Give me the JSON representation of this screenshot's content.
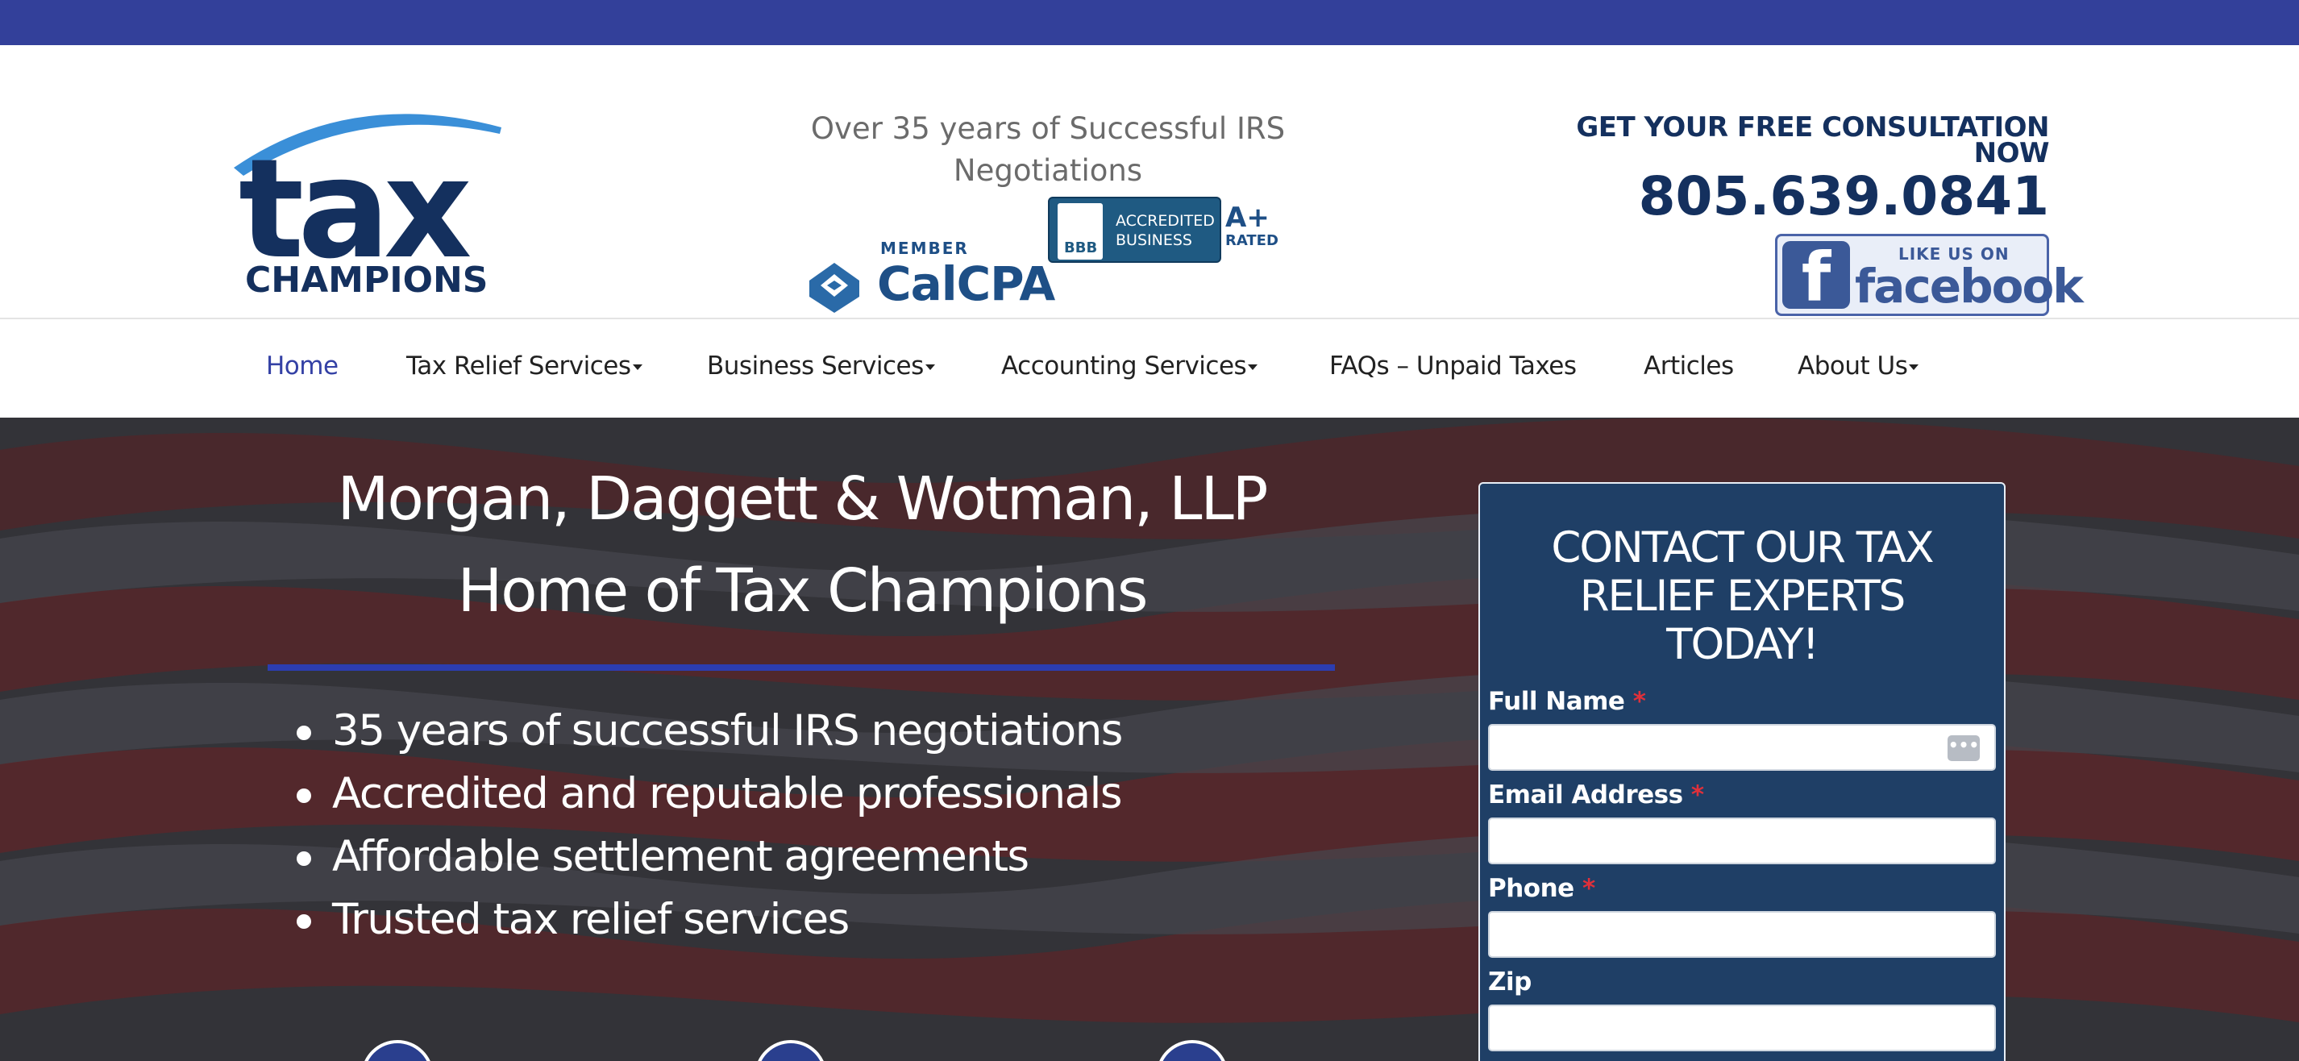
{
  "brand": {
    "logo_word": "tax",
    "logo_sub": "CHAMPIONS",
    "colors": {
      "navy": "#14305e",
      "accent_blue": "#3a8fd8",
      "topbar": "#33409a"
    }
  },
  "header": {
    "tagline": "Over 35 years of Successful IRS Negotiations",
    "calcpa_member": "MEMBER",
    "calcpa_name": "CalCPA",
    "bbb_seal": "BBB",
    "bbb_line1": "ACCREDITED",
    "bbb_line2": "BUSINESS",
    "bbb_rating": "A+",
    "bbb_rated": "RATED",
    "cta": "GET YOUR FREE CONSULTATION NOW",
    "phone": "805.639.0841",
    "fb_like": "LIKE US ON",
    "fb_word": "facebook",
    "fb_letter": "f"
  },
  "nav": {
    "items": [
      {
        "label": "Home",
        "active": true,
        "dropdown": false
      },
      {
        "label": "Tax Relief Services",
        "active": false,
        "dropdown": true
      },
      {
        "label": "Business Services",
        "active": false,
        "dropdown": true
      },
      {
        "label": "Accounting Services",
        "active": false,
        "dropdown": true
      },
      {
        "label": "FAQs – Unpaid Taxes",
        "active": false,
        "dropdown": false
      },
      {
        "label": "Articles",
        "active": false,
        "dropdown": false
      },
      {
        "label": "About Us",
        "active": false,
        "dropdown": true
      }
    ]
  },
  "hero": {
    "title_line1": "Morgan, Daggett & Wotman, LLP",
    "title_line2": "Home of Tax Champions",
    "bullets": [
      "35 years of successful IRS negotiations",
      "Accredited and reputable professionals",
      "Affordable settlement agreements",
      "Trusted tax relief services"
    ]
  },
  "form": {
    "title_line1": "CONTACT OUR TAX",
    "title_line2": "RELIEF EXPERTS",
    "title_line3": "TODAY!",
    "fields": [
      {
        "label": "Full Name",
        "required": true,
        "value": ""
      },
      {
        "label": "Email Address",
        "required": true,
        "value": ""
      },
      {
        "label": "Phone",
        "required": true,
        "value": ""
      },
      {
        "label": "Zip",
        "required": false,
        "value": ""
      }
    ],
    "required_mark": "*",
    "autofill_icon": "•••"
  }
}
